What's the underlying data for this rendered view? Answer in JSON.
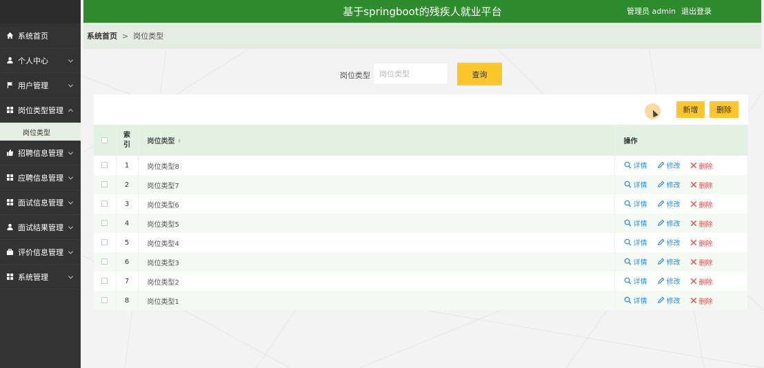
{
  "header": {
    "title": "基于springboot的残疾人就业平台",
    "user_label": "管理员 admin",
    "logout": "退出登录"
  },
  "sidebar": {
    "items": [
      {
        "label": "系统首页",
        "icon": "home-icon",
        "expandable": false
      },
      {
        "label": "个人中心",
        "icon": "user-icon",
        "expandable": true
      },
      {
        "label": "用户管理",
        "icon": "flag-icon",
        "expandable": true
      },
      {
        "label": "岗位类型管理",
        "icon": "grid-icon",
        "expandable": true,
        "expanded": true
      },
      {
        "label": "招聘信息管理",
        "icon": "thumbs-up-icon",
        "expandable": true
      },
      {
        "label": "应聘信息管理",
        "icon": "grid-icon",
        "expandable": true
      },
      {
        "label": "面试信息管理",
        "icon": "grid-icon",
        "expandable": true
      },
      {
        "label": "面试结果管理",
        "icon": "user-icon",
        "expandable": true
      },
      {
        "label": "评价信息管理",
        "icon": "briefcase-icon",
        "expandable": true
      },
      {
        "label": "系统管理",
        "icon": "grid-icon",
        "expandable": true
      }
    ],
    "submenu": {
      "label": "岗位类型"
    }
  },
  "breadcrumb": {
    "home": "系统首页",
    "separator": ">",
    "current": "岗位类型"
  },
  "search": {
    "label": "岗位类型",
    "placeholder": "岗位类型",
    "button": "查询"
  },
  "toolbar": {
    "add": "新增",
    "delete": "删除"
  },
  "table": {
    "headers": {
      "index": "索引",
      "name": "岗位类型",
      "ops": "操作"
    },
    "rows": [
      {
        "index": "1",
        "name": "岗位类型8"
      },
      {
        "index": "2",
        "name": "岗位类型7"
      },
      {
        "index": "3",
        "name": "岗位类型6"
      },
      {
        "index": "4",
        "name": "岗位类型5"
      },
      {
        "index": "5",
        "name": "岗位类型4"
      },
      {
        "index": "6",
        "name": "岗位类型3"
      },
      {
        "index": "7",
        "name": "岗位类型2"
      },
      {
        "index": "8",
        "name": "岗位类型1"
      }
    ],
    "ops": {
      "detail": "详情",
      "edit": "修改",
      "delete": "删除"
    }
  },
  "colors": {
    "header_green": "#2e8b2e",
    "sidebar_dark": "#333333",
    "accent_yellow": "#fcc62c",
    "link_blue": "#2f8fd6",
    "delete_red": "#d9534f"
  }
}
